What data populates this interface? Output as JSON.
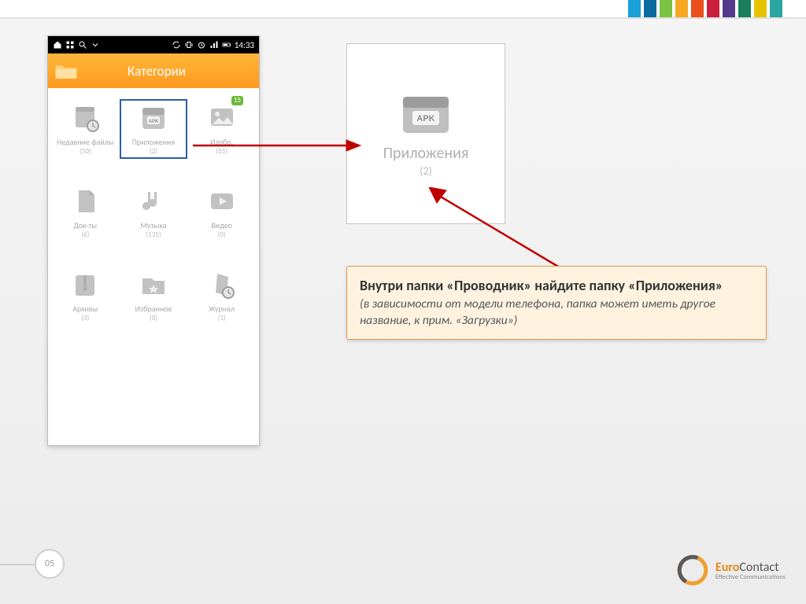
{
  "top_stripe_colors": [
    "#1aa2d9",
    "#0b6aa0",
    "#7cc242",
    "#f7a823",
    "#e94e1b",
    "#ca1f3d",
    "#533a8b",
    "#1a7f5c",
    "#e8c400",
    "#2aa5a0"
  ],
  "statusbar": {
    "time": "14:33"
  },
  "header": {
    "title": "Категории"
  },
  "categories": [
    {
      "name": "recent",
      "label": "Недавние файлы",
      "count": "(50)"
    },
    {
      "name": "apps",
      "label": "Приложения",
      "count": "(2)",
      "selected": true
    },
    {
      "name": "images",
      "label": "Изобр.",
      "count": "(55)",
      "badge": "15"
    },
    {
      "name": "docs",
      "label": "Док-ты",
      "count": "(6)"
    },
    {
      "name": "music",
      "label": "Музыка",
      "count": "(135)"
    },
    {
      "name": "video",
      "label": "Видео",
      "count": "(0)"
    },
    {
      "name": "archives",
      "label": "Архивы",
      "count": "(3)"
    },
    {
      "name": "favorites",
      "label": "Избранное",
      "count": "(0)"
    },
    {
      "name": "log",
      "label": "Журнал",
      "count": "(1)"
    }
  ],
  "detail": {
    "label": "Приложения",
    "count": "(2)"
  },
  "callout": {
    "main": "Внутри папки «Проводник» найдите папку «Приложения»",
    "sub": "(в зависимости от модели телефона, папка может иметь другое название, к прим. «Загрузки»)"
  },
  "page_number": "05",
  "brand": {
    "a": "Euro",
    "b": "Contact",
    "tag": "Effective Communications"
  }
}
